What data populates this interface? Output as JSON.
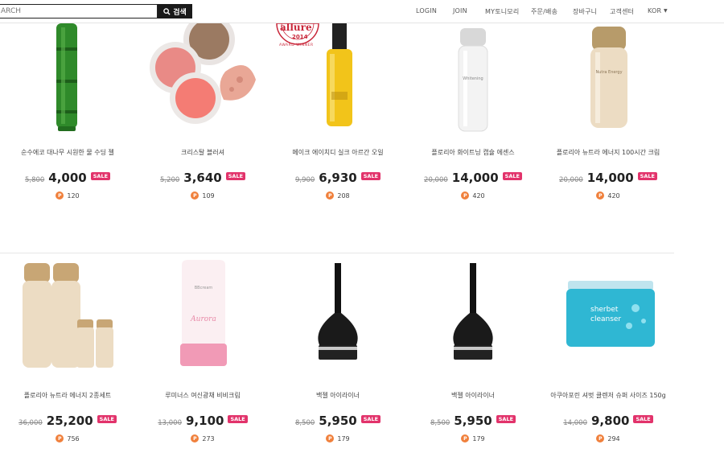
{
  "header": {
    "search": {
      "value": "ARCH",
      "button_label": "검색"
    },
    "nav": [
      {
        "label": "LOGIN"
      },
      {
        "label": "JOIN"
      },
      {
        "label": "MY토니모리"
      },
      {
        "label": "주문/배송"
      },
      {
        "label": "장바구니"
      },
      {
        "label": "고객센터"
      },
      {
        "label": "KOR"
      }
    ]
  },
  "badge": {
    "line1": "allure",
    "line2": "2014",
    "line3": "AWARD WINNER"
  },
  "products": [
    {
      "name": "순수에코 대나무 시원한 물 수딩 젤",
      "old_price": "5,800",
      "price": "4,000",
      "sale": "SALE",
      "points": "120"
    },
    {
      "name": "크리스탈 블러셔",
      "old_price": "5,200",
      "price": "3,640",
      "sale": "SALE",
      "points": "109"
    },
    {
      "name": "메이크 에이치디 실크 아르간 오일",
      "old_price": "9,900",
      "price": "6,930",
      "sale": "SALE",
      "points": "208"
    },
    {
      "name": "플로리아 화이트닝 캡슐 에센스",
      "old_price": "20,000",
      "price": "14,000",
      "sale": "SALE",
      "points": "420"
    },
    {
      "name": "플로리아 뉴트라 에너지 100시간 크림",
      "old_price": "20,000",
      "price": "14,000",
      "sale": "SALE",
      "points": "420"
    },
    {
      "name": "플로리아 뉴트라 에너지 2종세트",
      "old_price": "36,000",
      "price": "25,200",
      "sale": "SALE",
      "points": "756"
    },
    {
      "name": "루미너스 여신광채 비비크림",
      "old_price": "13,000",
      "price": "9,100",
      "sale": "SALE",
      "points": "273"
    },
    {
      "name": "백젤 아이라이너",
      "old_price": "8,500",
      "price": "5,950",
      "sale": "SALE",
      "points": "179"
    },
    {
      "name": "백젤 아이라이너",
      "old_price": "8,500",
      "price": "5,950",
      "sale": "SALE",
      "points": "179"
    },
    {
      "name": "아쿠아포린 셔벗 클렌저 슈퍼 사이즈 150g",
      "old_price": "14,000",
      "price": "9,800",
      "sale": "SALE",
      "points": "294"
    }
  ],
  "point_icon": "P",
  "colors": {
    "sale_badge": "#e2336b",
    "point_coin": "#f0803c",
    "search_button": "#1a1a1a"
  }
}
